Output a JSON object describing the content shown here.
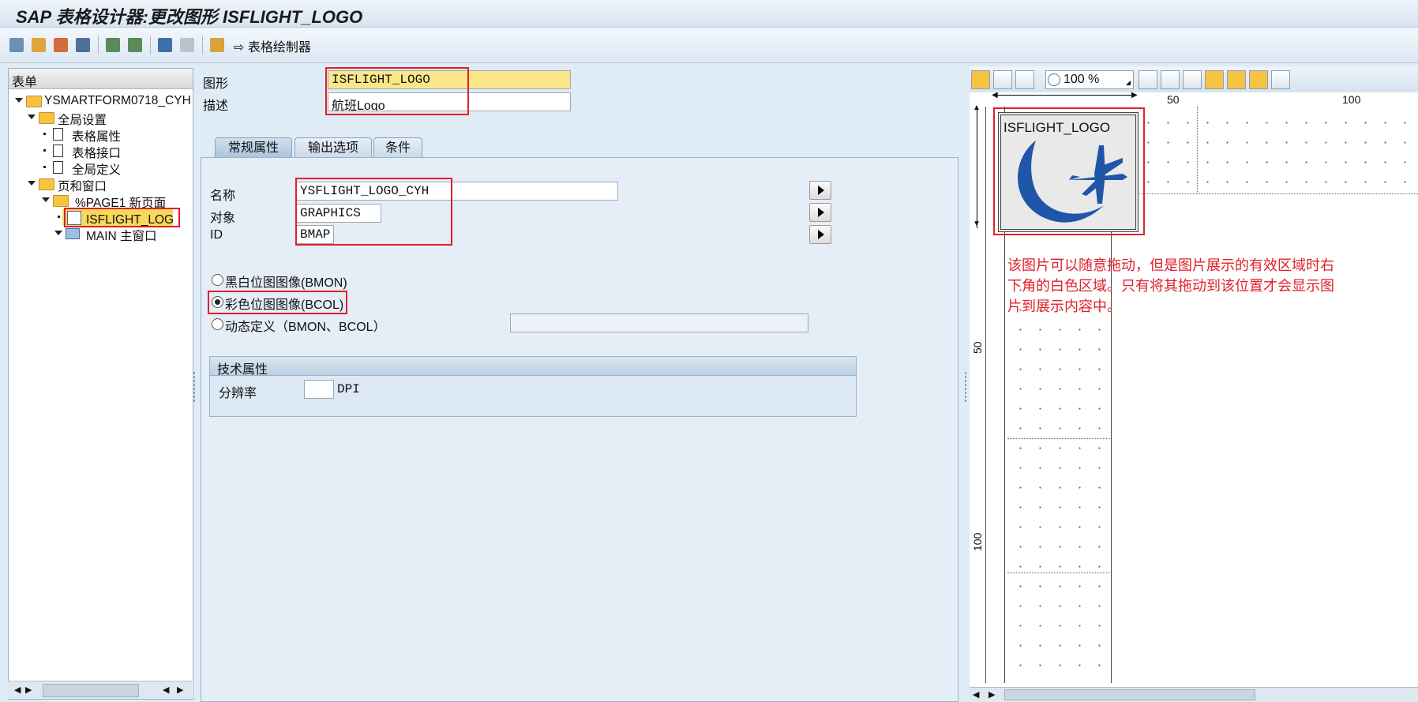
{
  "window": {
    "title": "SAP 表格设计器:更改图形 ISFLIGHT_LOGO"
  },
  "toolbar": {
    "form_painter_label": "表格绘制器"
  },
  "tree": {
    "header": "表单",
    "items": [
      {
        "label": "YSMARTFORM0718_CYH"
      },
      {
        "label": "全局设置"
      },
      {
        "label": "表格属性"
      },
      {
        "label": "表格接口"
      },
      {
        "label": "全局定义"
      },
      {
        "label": "页和窗口"
      },
      {
        "label": "%PAGE1 新页面"
      },
      {
        "label": "ISFLIGHT_LOGO 图"
      },
      {
        "label": "MAIN 主窗口"
      }
    ]
  },
  "header_fields": {
    "graphic_label": "图形",
    "graphic_value": "ISFLIGHT_LOGO",
    "desc_label": "描述",
    "desc_value": "航班Logo"
  },
  "tabs": [
    {
      "label": "常规属性",
      "active": true
    },
    {
      "label": "输出选项",
      "active": false
    },
    {
      "label": "条件",
      "active": false
    }
  ],
  "general": {
    "name_label": "名称",
    "name_value": "YSFLIGHT_LOGO_CYH",
    "object_label": "对象",
    "object_value": "GRAPHICS",
    "id_label": "ID",
    "id_value": "BMAP",
    "radios": [
      {
        "label": "黑白位图图像(BMON)",
        "checked": false
      },
      {
        "label": "彩色位图图像(BCOL)",
        "checked": true
      },
      {
        "label": "动态定义（BMON、BCOL）",
        "checked": false
      }
    ],
    "dynamic_value": ""
  },
  "tech": {
    "title": "技术属性",
    "resolution_label": "分辨率",
    "resolution_value": "",
    "resolution_unit": "DPI"
  },
  "preview": {
    "zoom": "100 %",
    "ruler_h": [
      "50",
      "100"
    ],
    "ruler_v": [
      "50",
      "100"
    ],
    "graphic_caption": "ISFLIGHT_LOGO",
    "note": "该图片可以随意拖动，但是图片展示的有效区域时右下角的白色区域。只有将其拖动到该位置才会显示图片到展示内容中。"
  },
  "colors": {
    "accent_red": "#e0202a",
    "logo_blue": "#1f56a8"
  }
}
